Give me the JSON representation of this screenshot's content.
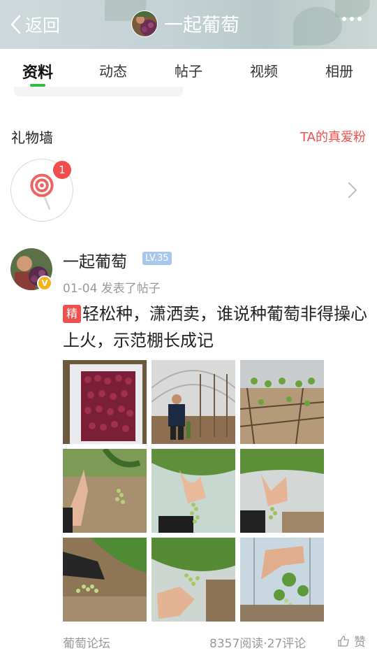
{
  "header": {
    "back_label": "返回",
    "title": "一起葡萄"
  },
  "tabs": [
    {
      "label": "资料"
    },
    {
      "label": "动态"
    },
    {
      "label": "帖子"
    },
    {
      "label": "视频"
    },
    {
      "label": "相册"
    }
  ],
  "gift_wall": {
    "title": "礼物墙",
    "fans_link": "TA的真爱粉",
    "gift_count": "1"
  },
  "post": {
    "author": "一起葡萄",
    "level": "LV.35",
    "meta": "01-04 发表了帖子",
    "tag": "精",
    "title": "轻松种，潇洒卖，谁说种葡萄非得操心上火，示范棚长成记",
    "forum": "葡萄论坛",
    "stats": "8357阅读·27评论",
    "like_label": "赞"
  },
  "colors": {
    "accent": "#2fbd48",
    "red": "#f04e4e",
    "level": "#a9c6ec",
    "verified": "#f5b31a"
  }
}
